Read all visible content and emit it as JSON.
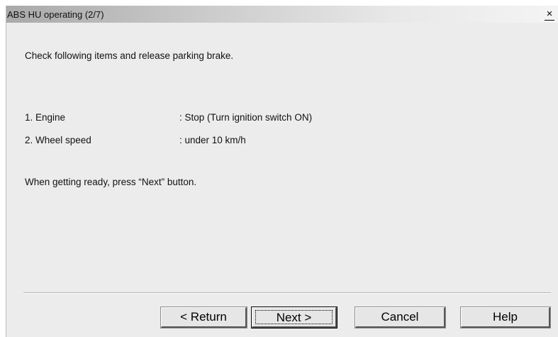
{
  "window": {
    "title": "ABS HU operating (2/7)",
    "close_glyph": "×"
  },
  "content": {
    "instruction": "Check following items and release parking brake.",
    "items": [
      {
        "label": "1. Engine",
        "value": ": Stop (Turn ignition switch ON)"
      },
      {
        "label": "2. Wheel speed",
        "value": ": under 10 km/h"
      }
    ],
    "prompt": "When getting ready, press “Next” button."
  },
  "buttons": {
    "return_label": "< Return",
    "next_label": "Next >",
    "cancel_label": "Cancel",
    "help_label": "Help"
  },
  "colors": {
    "dialog_background": "#ececec",
    "titlebar_gradient_start": "#a9a9a9",
    "titlebar_gradient_end": "#f4f4f4"
  }
}
